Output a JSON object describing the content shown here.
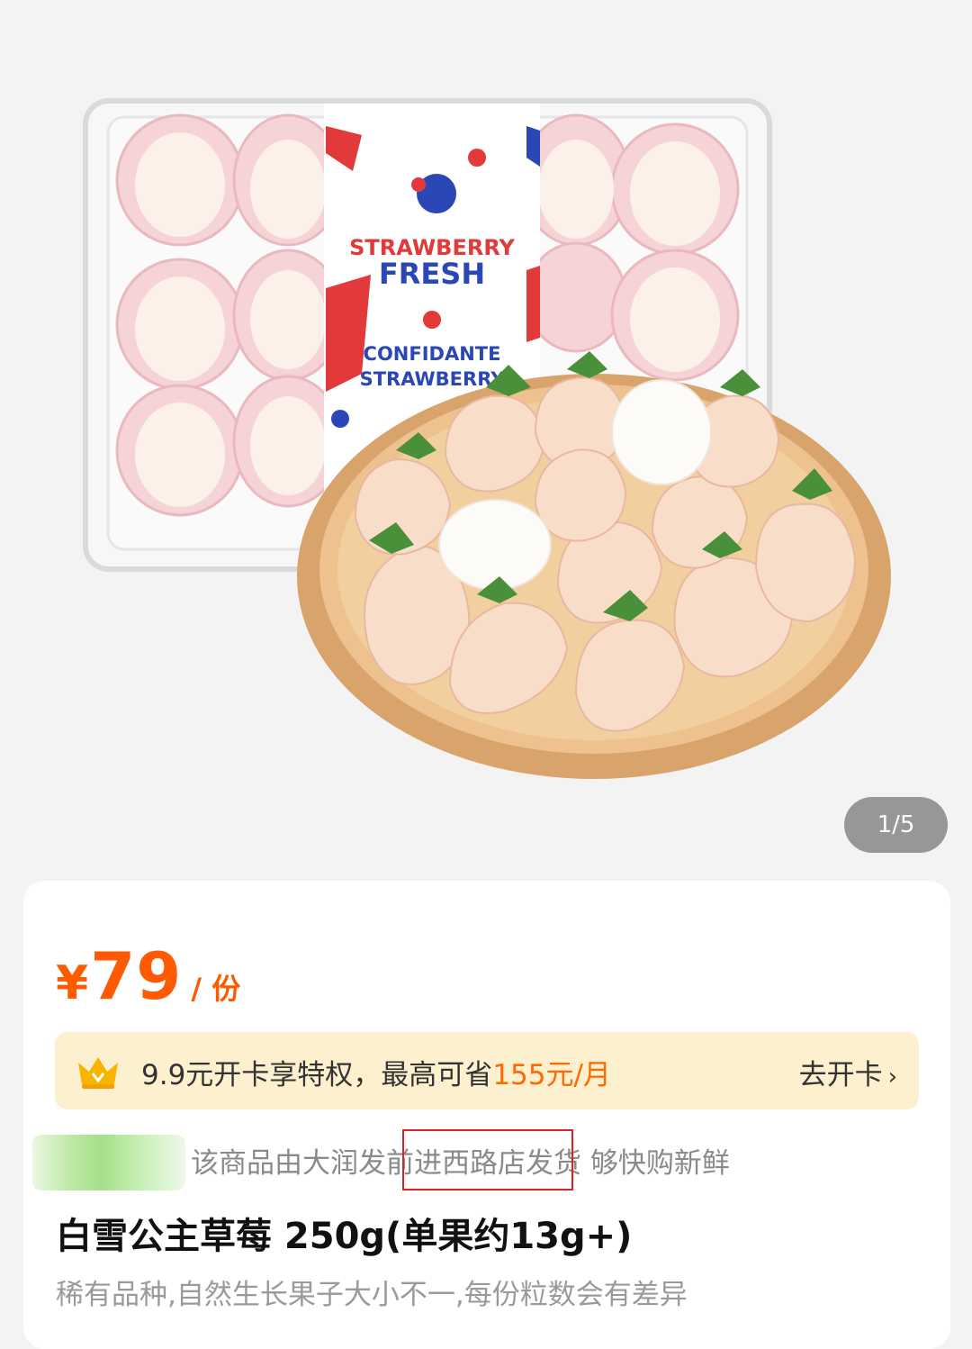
{
  "gallery": {
    "pager": "1/5",
    "package_texts": [
      "STRAWBERRY",
      "FRESH",
      "CONFIDANTE",
      "STRAWBERRY"
    ]
  },
  "product": {
    "price_symbol": "¥",
    "price": "79",
    "unit": "/ 份",
    "title": "白雪公主草莓 250g(单果约13g+)",
    "subtitle": "稀有品种,自然生长果子大小不一,每份粒数会有差异"
  },
  "membership": {
    "text_prefix": "9.9元开卡享特权，最高可省",
    "highlight": "155元/月",
    "button_label": "去开卡",
    "button_chevron": "›"
  },
  "shipping": {
    "text_prefix": "该商品由大润发",
    "store": "前进西路店",
    "text_suffix": "发货 够快购新鲜"
  },
  "colors": {
    "price": "#ff5a00",
    "highlight": "#ff6a00",
    "vip_bg": "#fdf0cf"
  }
}
